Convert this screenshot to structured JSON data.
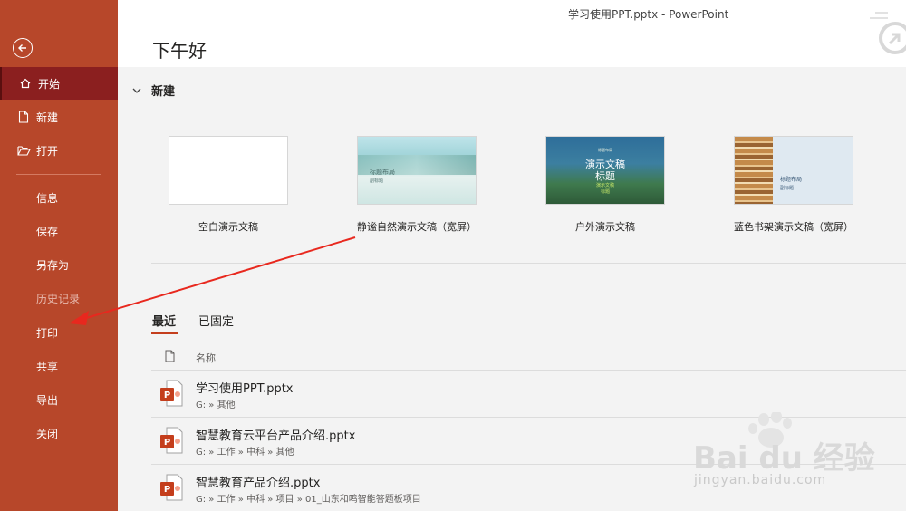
{
  "window": {
    "title": "学习使用PPT.pptx  -  PowerPoint"
  },
  "sidebar": {
    "items": [
      {
        "id": "home",
        "label": "开始",
        "icon": "home-icon",
        "active": true
      },
      {
        "id": "new",
        "label": "新建",
        "icon": "new-file-icon"
      },
      {
        "id": "open",
        "label": "打开",
        "icon": "folder-open-icon"
      },
      {
        "id": "info",
        "label": "信息"
      },
      {
        "id": "save",
        "label": "保存"
      },
      {
        "id": "saveas",
        "label": "另存为"
      },
      {
        "id": "history",
        "label": "历史记录",
        "disabled": true
      },
      {
        "id": "print",
        "label": "打印"
      },
      {
        "id": "share",
        "label": "共享"
      },
      {
        "id": "export",
        "label": "导出"
      },
      {
        "id": "close",
        "label": "关闭"
      }
    ],
    "color": "#b7472a",
    "active_color": "#8b1f1f"
  },
  "main": {
    "greeting": "下午好",
    "new_section": {
      "label": "新建"
    },
    "templates": [
      {
        "name": "空白演示文稿"
      },
      {
        "name": "静谧自然演示文稿（宽屏）",
        "thumb_title": "标题布局",
        "thumb_sub": "副标题"
      },
      {
        "name": "户外演示文稿",
        "thumb_tag": "标题布局",
        "thumb_title": "演示文稿",
        "thumb_title2": "标题",
        "thumb_sub": "演示文稿",
        "thumb_sub2": "标题"
      },
      {
        "name": "蓝色书架演示文稿（宽屏）",
        "thumb_title": "标题布局",
        "thumb_sub": "副标题"
      }
    ],
    "tabs": [
      {
        "label": "最近",
        "active": true
      },
      {
        "label": "已固定"
      }
    ],
    "file_list": {
      "column_name": "名称",
      "files": [
        {
          "name": "学习使用PPT.pptx",
          "path": "G: » 其他"
        },
        {
          "name": "智慧教育云平台产品介绍.pptx",
          "path": "G: » 工作 » 中科 » 其他"
        },
        {
          "name": "智慧教育产品介绍.pptx",
          "path": "G: » 工作 » 中科 » 项目 » 01_山东和鸣智能答题板项目"
        }
      ]
    }
  },
  "watermark": {
    "brand": "Bai du 经验",
    "url": "jingyan.baidu.com"
  },
  "colors": {
    "accent": "#c43e1c",
    "ppt_icon": "#c43e1c",
    "arrow": "#e8281e"
  }
}
